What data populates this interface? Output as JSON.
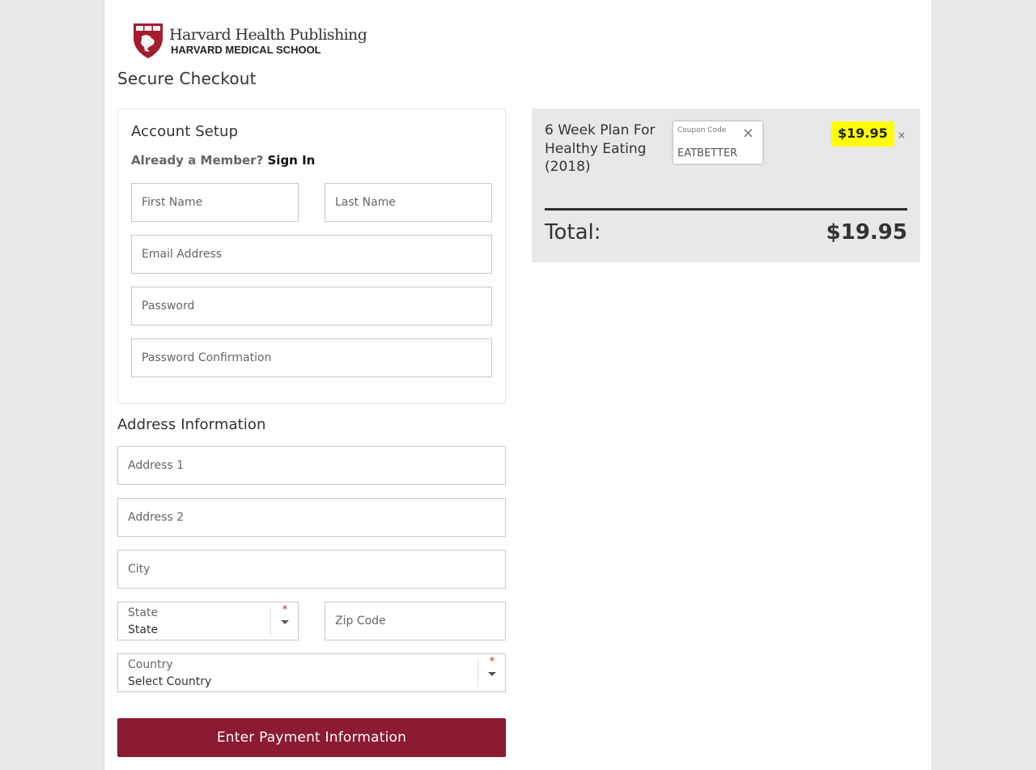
{
  "brand": {
    "name": "Harvard Health Publishing",
    "subname": "HARVARD MEDICAL SCHOOL",
    "colors": {
      "primary": "#8c1a32",
      "highlight": "#ffff00"
    }
  },
  "page_title": "Secure Checkout",
  "account": {
    "title": "Account Setup",
    "member_prompt": "Already a Member?",
    "sign_in_label": "Sign In",
    "fields": {
      "first_name": {
        "placeholder": "First Name",
        "value": ""
      },
      "last_name": {
        "placeholder": "Last Name",
        "value": ""
      },
      "email": {
        "placeholder": "Email Address",
        "value": ""
      },
      "password": {
        "placeholder": "Password",
        "value": ""
      },
      "password_confirmation": {
        "placeholder": "Password Confirmation",
        "value": ""
      }
    }
  },
  "address": {
    "title": "Address Information",
    "fields": {
      "address1": {
        "placeholder": "Address 1",
        "value": ""
      },
      "address2": {
        "placeholder": "Address 2",
        "value": ""
      },
      "city": {
        "placeholder": "City",
        "value": ""
      },
      "zip": {
        "placeholder": "Zip Code",
        "value": ""
      }
    },
    "state": {
      "label": "State",
      "selected": "State",
      "required_mark": "*"
    },
    "country": {
      "label": "Country",
      "selected": "Select Country",
      "required_mark": "*"
    }
  },
  "submit_label": "Enter Payment Information",
  "summary": {
    "product_name": "6 Week Plan For Healthy Eating (2018)",
    "coupon": {
      "label": "Coupon Code",
      "value": "EATBETTER",
      "close_icon": "×"
    },
    "price": "$19.95",
    "remove_icon": "×",
    "total_label": "Total:",
    "total_value": "$19.95"
  }
}
